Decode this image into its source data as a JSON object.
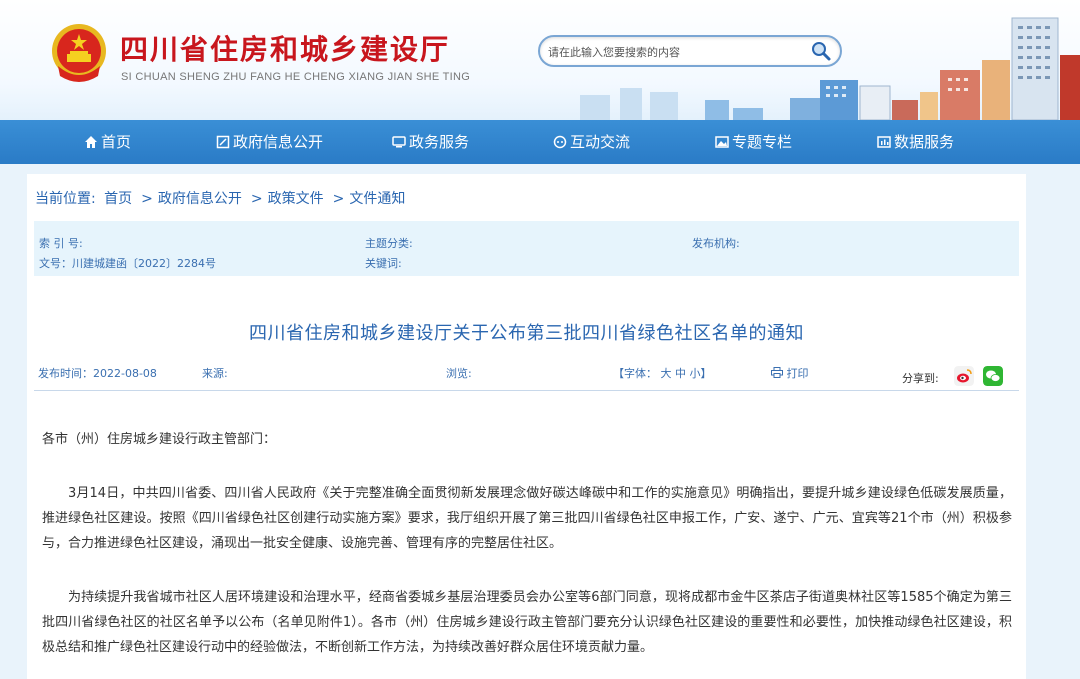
{
  "header": {
    "title": "四川省住房和城乡建设厅",
    "subtitle": "SI CHUAN SHENG ZHU FANG HE CHENG XIANG JIAN SHE TING",
    "search_placeholder": "请在此输入您要搜索的内容",
    "emblem_icon": "national-emblem-icon",
    "search_icon": "magnifier-icon"
  },
  "nav": {
    "items": [
      {
        "label": "首页",
        "icon": "home-icon"
      },
      {
        "label": "政府信息公开",
        "icon": "edit-icon"
      },
      {
        "label": "政务服务",
        "icon": "monitor-icon"
      },
      {
        "label": "互动交流",
        "icon": "chat-icon"
      },
      {
        "label": "专题专栏",
        "icon": "image-icon"
      },
      {
        "label": "数据服务",
        "icon": "data-icon"
      }
    ]
  },
  "breadcrumb": {
    "prefix": "当前位置:",
    "items": [
      "首页",
      "政府信息公开",
      "政策文件",
      "文件通知"
    ],
    "separator": ">"
  },
  "meta": {
    "index_label": "索 引 号:",
    "subject_label": "主题分类:",
    "publisher_label": "发布机构:",
    "doc_number": "文号：川建城建函〔2022〕2284号",
    "keywords_label": "关键词:"
  },
  "article": {
    "title": "四川省住房和城乡建设厅关于公布第三批四川省绿色社区名单的通知",
    "publish_time": "发布时间：2022-08-08",
    "source_label": "来源:",
    "views_label": "浏览:",
    "font_label": "【字体：",
    "font_sizes": [
      "大",
      "中",
      "小"
    ],
    "font_close": "】",
    "print_label": "打印",
    "share_label": "分享到:",
    "salutation": "各市（州）住房城乡建设行政主管部门：",
    "paragraphs": [
      "3月14日，中共四川省委、四川省人民政府《关于完整准确全面贯彻新发展理念做好碳达峰碳中和工作的实施意见》明确指出，要提升城乡建设绿色低碳发展质量，推进绿色社区建设。按照《四川省绿色社区创建行动实施方案》要求，我厅组织开展了第三批四川省绿色社区申报工作，广安、遂宁、广元、宜宾等21个市（州）积极参与，合力推进绿色社区建设，涌现出一批安全健康、设施完善、管理有序的完整居住社区。",
      "为持续提升我省城市社区人居环境建设和治理水平，经商省委城乡基层治理委员会办公室等6部门同意，现将成都市金牛区茶店子街道奥林社区等1585个确定为第三批四川省绿色社区的社区名单予以公布（名单见附件1）。各市（州）住房城乡建设行政主管部门要充分认识绿色社区建设的重要性和必要性，加快推动绿色社区建设，积极总结和推广绿色社区建设行动中的经验做法，不断创新工作方法，为持续改善好群众居住环境贡献力量。"
    ]
  },
  "colors": {
    "brand_red": "#c8161d",
    "nav_blue": "#2a7bc6",
    "link_blue": "#2a66b0",
    "meta_bg": "#e6f4fc"
  }
}
